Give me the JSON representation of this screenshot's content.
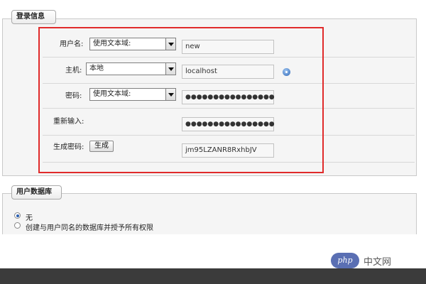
{
  "login_info": {
    "legend": "登录信息",
    "username": {
      "label": "用户名:",
      "select_value": "使用文本域:",
      "input_value": "new"
    },
    "host": {
      "label": "主机:",
      "select_value": "本地",
      "input_value": "localhost",
      "help_icon": "help-icon"
    },
    "password": {
      "label": "密码:",
      "select_value": "使用文本域:",
      "input_value": "●●●●●●●●●●●●●●●●"
    },
    "reenter": {
      "label": "重新输入:",
      "input_value": "●●●●●●●●●●●●●●●●"
    },
    "generate": {
      "label": "生成密码:",
      "button_label": "生成",
      "input_value": "jm95LZANR8RxhbJV"
    }
  },
  "user_db": {
    "legend": "用户数据库",
    "options": [
      {
        "label": "无",
        "checked": true
      },
      {
        "label": "创建与用户同名的数据库并授予所有权限",
        "checked": false
      }
    ]
  },
  "watermark": {
    "logo": "php",
    "text": "中文网"
  },
  "colors": {
    "highlight": "#e02b2b",
    "panel_bg": "#f5f5f5",
    "footer": "#3b3b3b"
  }
}
